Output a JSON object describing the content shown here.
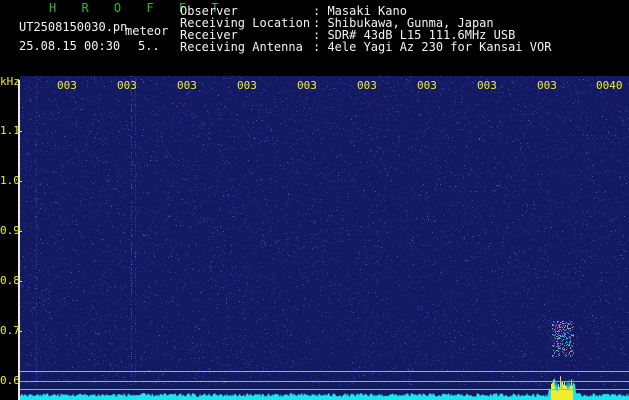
{
  "header": {
    "app_title": "H R O F F T",
    "filename": "UT2508150030.pn",
    "tag": "meteor",
    "date_time": "25.08.15 00:30",
    "count": "5..",
    "info": [
      {
        "label": "Observer",
        "value": ": Masaki Kano"
      },
      {
        "label": "Receiving Location",
        "value": ": Shibukawa, Gunma, Japan"
      },
      {
        "label": "Receiver",
        "value": ": SDR# 43dB L15 111.6MHz USB"
      },
      {
        "label": "Receiving Antenna",
        "value": ": 4ele Yagi Az 230 for Kansai VOR"
      }
    ]
  },
  "plot": {
    "y_unit": "kHz",
    "y_ticks": [
      "1.1",
      "1.0",
      "0.9",
      "0.8",
      "0.7",
      "0.6"
    ],
    "x_ticks": [
      "003",
      "003",
      "003",
      "003",
      "003",
      "003",
      "003",
      "003",
      "003",
      "0040"
    ],
    "colors": {
      "background": "#141a62",
      "noise": "#2d3fb0",
      "spectrum": "#19e6ee",
      "echo": "#f2ec2a",
      "echo_core": "#e3342f",
      "label": "#f2ec2a"
    }
  }
}
